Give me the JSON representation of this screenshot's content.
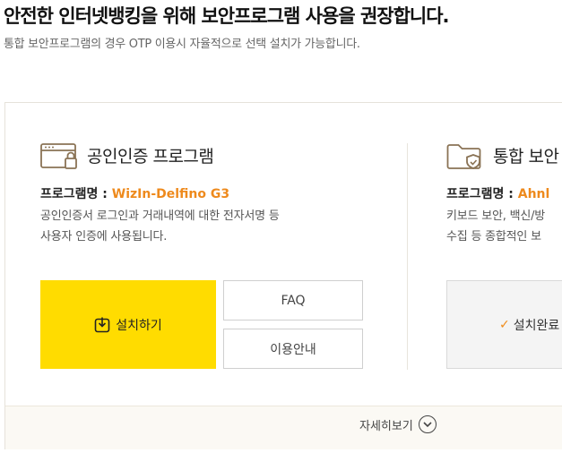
{
  "header": {
    "headline": "안전한 인터넷뱅킹을 위해 보안프로그램 사용을 권장합니다.",
    "subline": "통합 보안프로그램의 경우 OTP 이용시 자율적으로 선택 설치가 가능합니다."
  },
  "programs": [
    {
      "title": "공인인증 프로그램",
      "icon": "browser-lock-icon",
      "name_label": "프로그램명 : ",
      "name_value": "WizIn-Delfino G3",
      "desc_line1": "공인인증서 로그인과 거래내역에 대한 전자서명 등",
      "desc_line2": "사용자 인증에 사용됩니다.",
      "install_label": "설치하기",
      "faq_label": "FAQ",
      "guide_label": "이용안내"
    },
    {
      "title": "통합 보안",
      "icon": "folder-shield-icon",
      "name_label": "프로그램명 : ",
      "name_value": "Ahnl",
      "desc_line1": "키보드 보안, 백신/방",
      "desc_line2": "수집 등 종합적인 보",
      "installed_label": "설치완료"
    }
  ],
  "footer": {
    "more_label": "자세히보기"
  },
  "colors": {
    "accent_yellow": "#ffdc00",
    "accent_orange": "#ee8a1d"
  }
}
